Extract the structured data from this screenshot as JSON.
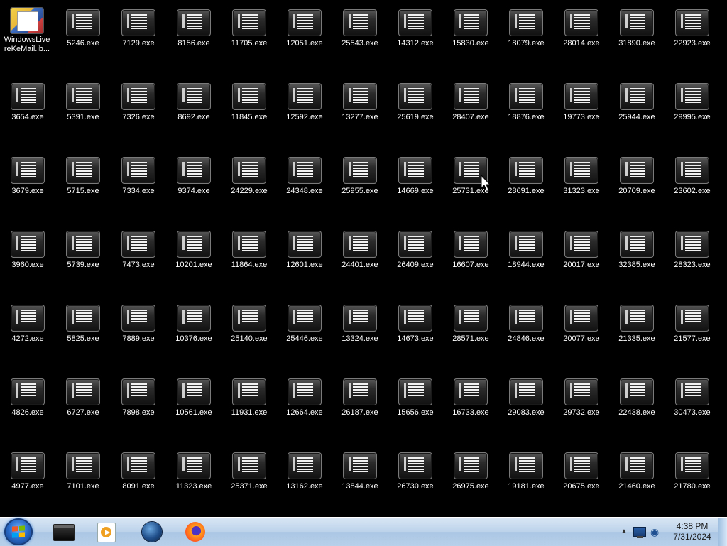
{
  "desktop": {
    "special_icon": {
      "label": "WindowsLive reKeMail.ib...",
      "icon": "windows-live-shortcut-icon"
    },
    "rows": [
      [
        "5246.exe",
        "7129.exe",
        "8156.exe",
        "11705.exe",
        "12051.exe",
        "25543.exe",
        "14312.exe",
        "15830.exe",
        "18079.exe",
        "28014.exe",
        "31890.exe",
        "22923.exe"
      ],
      [
        "3654.exe",
        "5391.exe",
        "7326.exe",
        "8692.exe",
        "11845.exe",
        "12592.exe",
        "13277.exe",
        "25619.exe",
        "28407.exe",
        "18876.exe",
        "19773.exe",
        "25944.exe",
        "29995.exe"
      ],
      [
        "3679.exe",
        "5715.exe",
        "7334.exe",
        "9374.exe",
        "24229.exe",
        "24348.exe",
        "25955.exe",
        "14669.exe",
        "25731.exe",
        "28691.exe",
        "31323.exe",
        "20709.exe",
        "23602.exe"
      ],
      [
        "3960.exe",
        "5739.exe",
        "7473.exe",
        "10201.exe",
        "11864.exe",
        "12601.exe",
        "24401.exe",
        "26409.exe",
        "16607.exe",
        "18944.exe",
        "20017.exe",
        "32385.exe",
        "28323.exe"
      ],
      [
        "4272.exe",
        "5825.exe",
        "7889.exe",
        "10376.exe",
        "25140.exe",
        "25446.exe",
        "13324.exe",
        "14673.exe",
        "28571.exe",
        "24846.exe",
        "20077.exe",
        "21335.exe",
        "21577.exe"
      ],
      [
        "4826.exe",
        "6727.exe",
        "7898.exe",
        "10561.exe",
        "11931.exe",
        "12664.exe",
        "26187.exe",
        "15656.exe",
        "16733.exe",
        "29083.exe",
        "29732.exe",
        "22438.exe",
        "30473.exe"
      ],
      [
        "4977.exe",
        "7101.exe",
        "8091.exe",
        "11323.exe",
        "25371.exe",
        "13162.exe",
        "13844.exe",
        "26730.exe",
        "26975.exe",
        "19181.exe",
        "20675.exe",
        "21460.exe",
        "21780.exe"
      ]
    ],
    "file_icon": "console-exe-icon"
  },
  "taskbar": {
    "start": {
      "icon": "windows-start-orb-icon"
    },
    "apps": [
      {
        "name": "cmd",
        "icon": "command-prompt-icon"
      },
      {
        "name": "media",
        "icon": "media-player-icon"
      },
      {
        "name": "firewall",
        "icon": "globe-security-icon"
      },
      {
        "name": "firefox",
        "icon": "firefox-icon"
      }
    ],
    "tray": {
      "arrow": "▲",
      "time": "4:38 PM",
      "date": "7/31/2024"
    }
  }
}
